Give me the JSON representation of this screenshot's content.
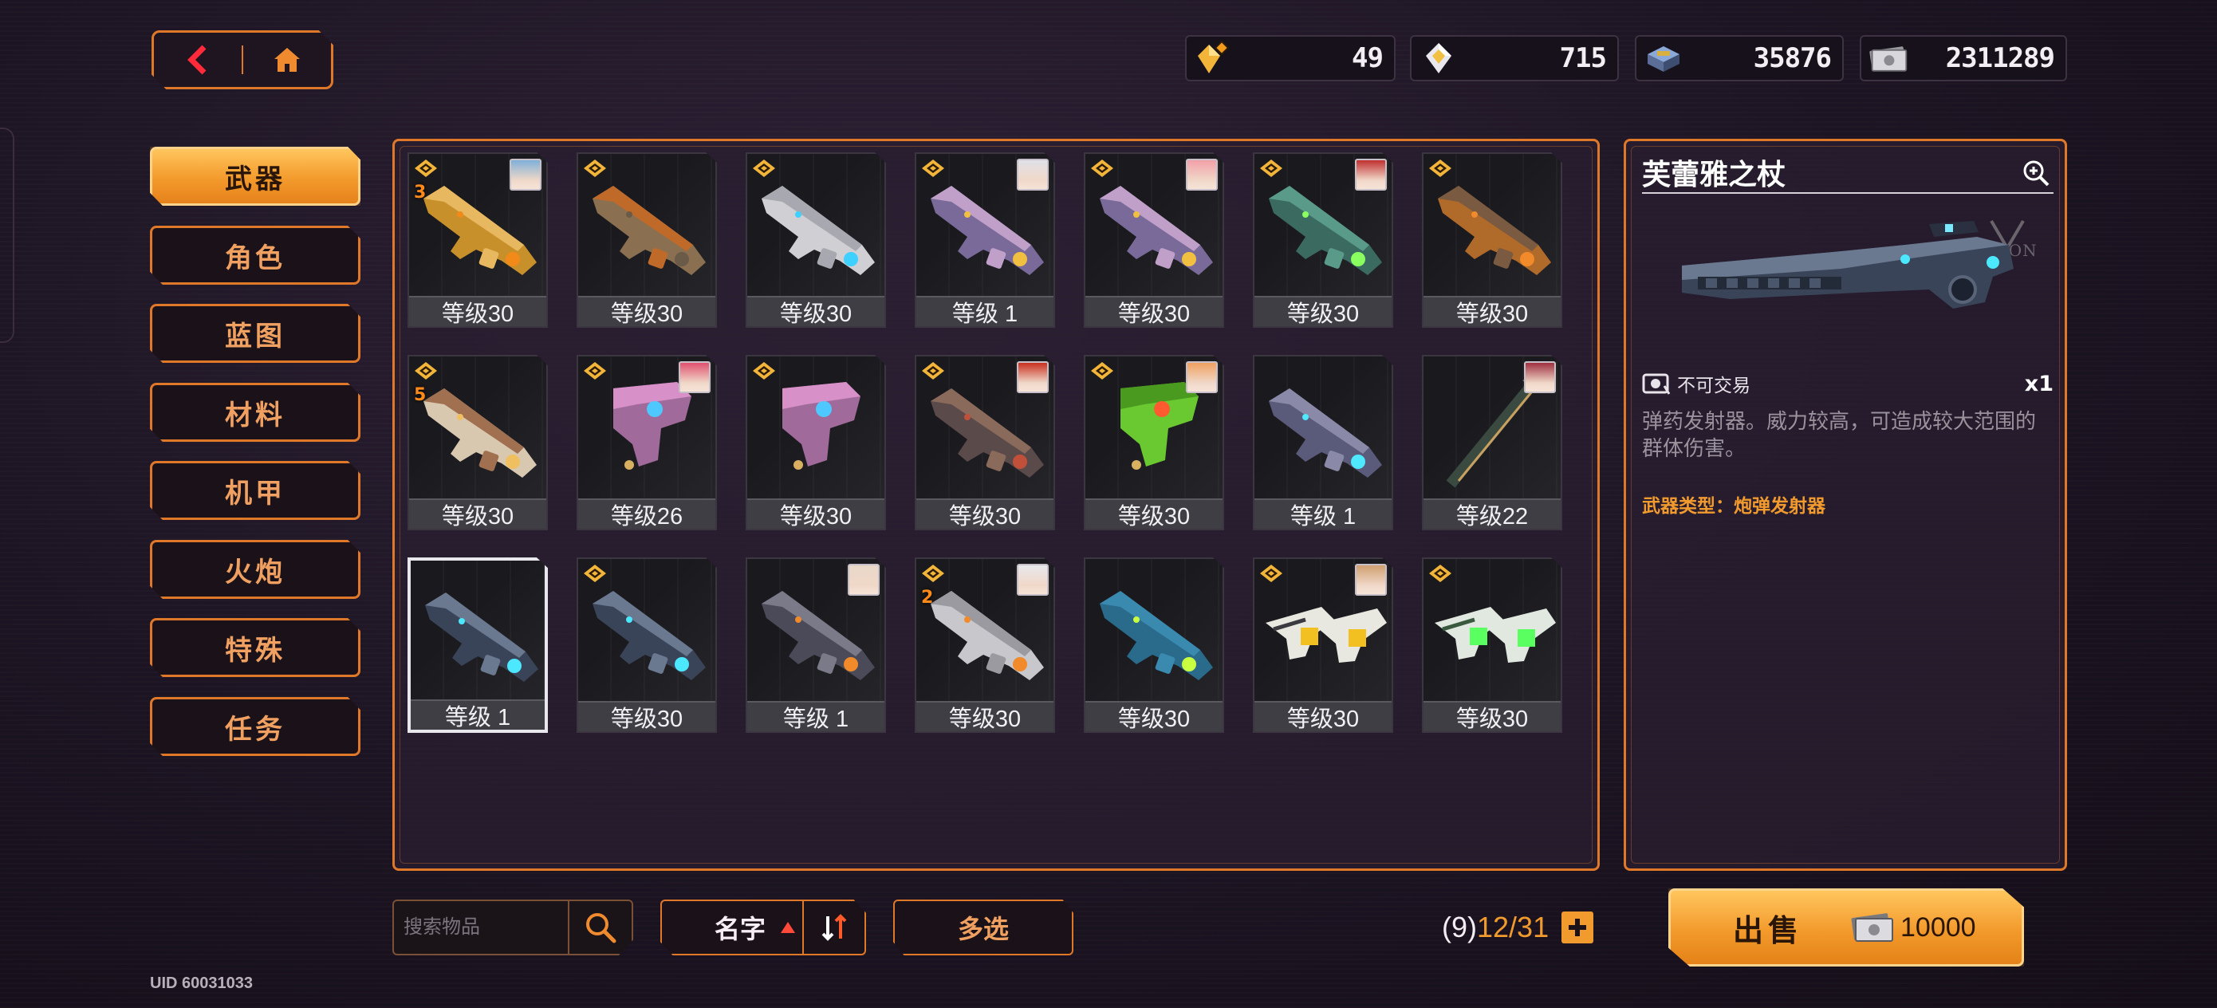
{
  "nav": {
    "back_icon": "chevron-left-icon",
    "home_icon": "home-icon"
  },
  "currencies": [
    {
      "name": "gold-crystal",
      "icon": "gold-crystal-icon",
      "value": "49"
    },
    {
      "name": "silver-crystal",
      "icon": "silver-crystal-icon",
      "value": "715"
    },
    {
      "name": "chip",
      "icon": "chip-icon",
      "value": "35876"
    },
    {
      "name": "money",
      "icon": "banknote-icon",
      "value": "2311289"
    }
  ],
  "side_menu": [
    {
      "id": "weapon",
      "label": "武器",
      "active": true
    },
    {
      "id": "character",
      "label": "角色",
      "active": false
    },
    {
      "id": "blueprint",
      "label": "蓝图",
      "active": false
    },
    {
      "id": "material",
      "label": "材料",
      "active": false
    },
    {
      "id": "mecha",
      "label": "机甲",
      "active": false
    },
    {
      "id": "cannon",
      "label": "火炮",
      "active": false
    },
    {
      "id": "special",
      "label": "特殊",
      "active": false
    },
    {
      "id": "mission",
      "label": "任务",
      "active": false
    }
  ],
  "items": [
    {
      "level": "等级30",
      "star": true,
      "rank": "3",
      "avatar": "#7fb0d8",
      "weapon": "gold",
      "selected": false
    },
    {
      "level": "等级30",
      "star": true,
      "rank": "",
      "avatar": "",
      "weapon": "camo-orange",
      "selected": false
    },
    {
      "level": "等级30",
      "star": true,
      "rank": "",
      "avatar": "",
      "weapon": "white-blue",
      "selected": false
    },
    {
      "level": "等级 1",
      "star": true,
      "rank": "",
      "avatar": "#e0e0e8",
      "weapon": "purple-gold",
      "selected": false
    },
    {
      "level": "等级30",
      "star": true,
      "rank": "",
      "avatar": "#f2a0a8",
      "weapon": "purple-gold",
      "selected": false
    },
    {
      "level": "等级30",
      "star": true,
      "rank": "",
      "avatar": "#c03030",
      "weapon": "teal-green",
      "selected": false
    },
    {
      "level": "等级30",
      "star": true,
      "rank": "",
      "avatar": "",
      "weapon": "orange-camo",
      "selected": false
    },
    {
      "level": "等级30",
      "star": true,
      "rank": "5",
      "avatar": "",
      "weapon": "white-gold",
      "selected": false
    },
    {
      "level": "等级26",
      "star": true,
      "rank": "",
      "avatar": "#e05070",
      "weapon": "pink-pistol",
      "selected": false
    },
    {
      "level": "等级30",
      "star": true,
      "rank": "",
      "avatar": "",
      "weapon": "pink-pistol",
      "selected": false
    },
    {
      "level": "等级30",
      "star": true,
      "rank": "",
      "avatar": "#c83020",
      "weapon": "gatling",
      "selected": false
    },
    {
      "level": "等级30",
      "star": true,
      "rank": "",
      "avatar": "#f0a060",
      "weapon": "green-frog",
      "selected": false
    },
    {
      "level": "等级 1",
      "star": false,
      "rank": "",
      "avatar": "",
      "weapon": "purple-heavy",
      "selected": false
    },
    {
      "level": "等级22",
      "star": false,
      "rank": "",
      "avatar": "#a03040",
      "weapon": "spear",
      "selected": false
    },
    {
      "level": "等级 1",
      "star": false,
      "rank": "",
      "avatar": "",
      "weapon": "dark-blue",
      "selected": true
    },
    {
      "level": "等级30",
      "star": true,
      "rank": "",
      "avatar": "",
      "weapon": "dark-blue",
      "selected": false
    },
    {
      "level": "等级 1",
      "star": false,
      "rank": "",
      "avatar": "#e8d8c8",
      "weapon": "dark-orange",
      "selected": false
    },
    {
      "level": "等级30",
      "star": true,
      "rank": "2",
      "avatar": "#e8e8ec",
      "weapon": "white-orange",
      "selected": false
    },
    {
      "level": "等级30",
      "star": false,
      "rank": "",
      "avatar": "",
      "weapon": "blue-green",
      "selected": false
    },
    {
      "level": "等级30",
      "star": true,
      "rank": "",
      "avatar": "#d0a070",
      "weapon": "dual-yellow",
      "selected": false
    },
    {
      "level": "等级30",
      "star": true,
      "rank": "",
      "avatar": "",
      "weapon": "dual-green",
      "selected": false
    }
  ],
  "detail": {
    "title": "芙蕾雅之杖",
    "zoom_icon": "zoom-in-icon",
    "trade_status": "不可交易",
    "quantity": "x1",
    "description": "弹药发射器。威力较高，可造成较大范围的群体伤害。",
    "weapon_type": "武器类型：炮弹发射器"
  },
  "bottom": {
    "search_placeholder": "搜索物品",
    "sort_label": "名字",
    "multi_select_label": "多选",
    "capacity_selected": "(9)",
    "capacity_count": "12/31",
    "sell_label": "出售",
    "sell_price": "10000"
  },
  "uid": "UID 60031033",
  "colors": {
    "accent": "#e0782a",
    "highlight": "#f19a2e",
    "panel": "#2a1e30"
  }
}
